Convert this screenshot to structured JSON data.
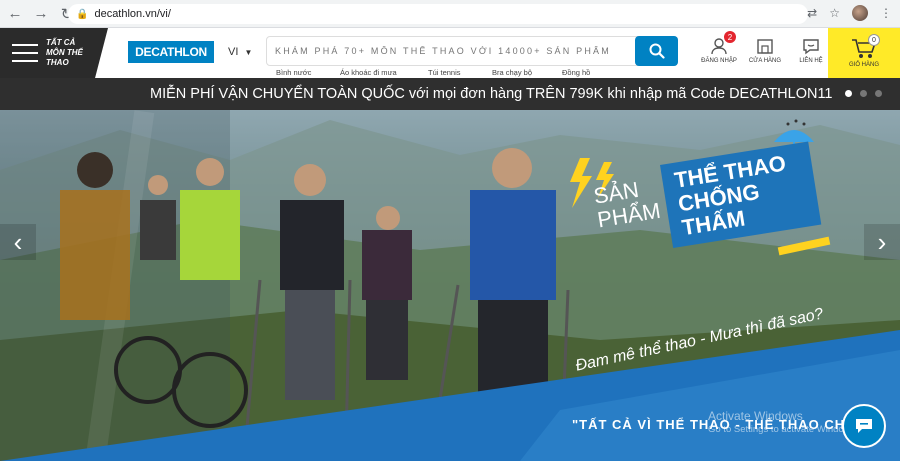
{
  "browser": {
    "url": "decathlon.vn/vi/"
  },
  "header": {
    "menu_label": "TẤT CẢ MÔN THỂ THAO",
    "logo_text": "DECATHLON",
    "language": "VI",
    "search_placeholder": "KHÁM PHÁ 70+ MÔN THỂ THAO VỚI 14000+ SẢN PHẨM",
    "suggestions": [
      "Bình nước",
      "Áo khoác đi mưa",
      "Túi tennis",
      "Bra chạy bộ",
      "Đồng hồ"
    ],
    "icons": [
      {
        "label": "ĐĂNG NHẬP",
        "icon": "user-icon",
        "badge": "2"
      },
      {
        "label": "CỬA HÀNG",
        "icon": "store-icon"
      },
      {
        "label": "LIÊN HỆ",
        "icon": "chat-bubble-icon"
      }
    ],
    "cart": {
      "label": "GIỎ HÀNG",
      "count": "0"
    }
  },
  "promo": {
    "text": "MIỄN PHÍ VẬN CHUYỂN TOÀN QUỐC với mọi đơn hàng TRÊN 799K khi nhập mã Code DECATHLON11",
    "slide_count": 3,
    "active_slide": 1
  },
  "hero": {
    "title_left": "SẢN PHẨM",
    "title_right": "THỂ THAO CHỐNG THẤM",
    "tagline": "Đam mê thể thao - Mưa thì đã sao?",
    "slogan": "\"TẤT CẢ VÌ THỂ THAO - THỂ THAO CHO TẤ",
    "colors": {
      "accent": "#0082c3",
      "band": "#1e74b9"
    }
  },
  "watermark": {
    "line1": "Activate Windows",
    "line2": "Go to Settings to activate Windows."
  }
}
